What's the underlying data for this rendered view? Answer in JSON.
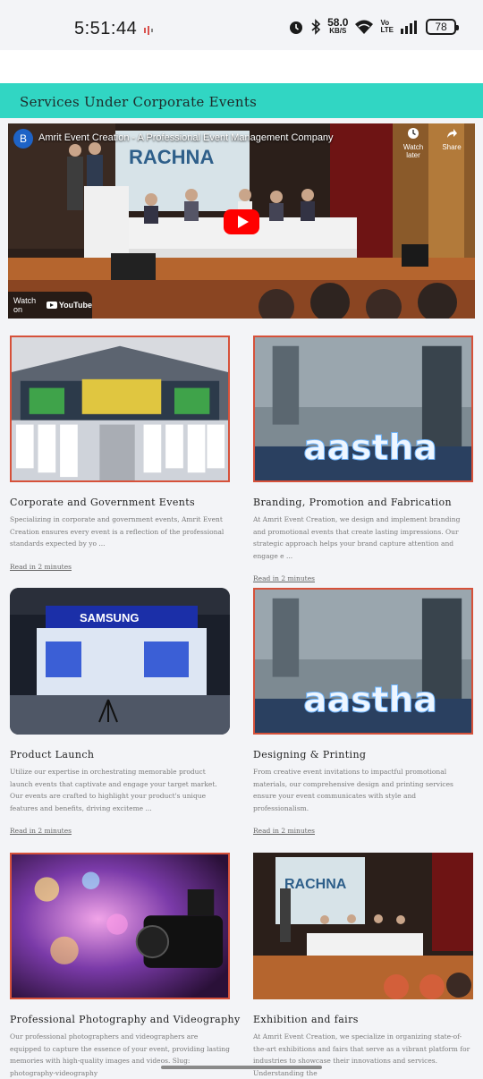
{
  "status_bar": {
    "time": "5:51:44",
    "net_speed_value": "58.0",
    "net_speed_unit": "KB/S",
    "volte_top": "Vo",
    "volte_bottom": "LTE",
    "battery": "78",
    "icons": [
      "screen-record-icon",
      "alarm-icon",
      "bluetooth-icon",
      "wifi-icon",
      "signal-icon"
    ]
  },
  "section": {
    "title": "Services Under Corporate Events",
    "header_color": "#31d6c3"
  },
  "video": {
    "channel_initial": "B",
    "title": "Amrit Event Creation - A Professional Event Management Company",
    "watch_later": "Watch later",
    "share": "Share",
    "watch_on": "Watch on",
    "youtube": "YouTube",
    "backdrop_text": "RACHNA"
  },
  "cards": [
    {
      "title": "Corporate and Government Events",
      "excerpt": "Specializing in corporate and government events, Amrit Event Creation ensures every event is a reflection of the professional standards expected by yo ...",
      "read": "Read in 2 minutes"
    },
    {
      "title": "Branding, Promotion and Fabrication",
      "excerpt": "At Amrit Event Creation, we design and implement branding and promotional events that create lasting impressions. Our strategic approach helps your brand capture attention and engage e ...",
      "read": "Read in 2 minutes",
      "image_text": "aastha"
    },
    {
      "title": "Product Launch",
      "excerpt": "Utilize our expertise in orchestrating memorable product launch events that captivate and engage your target market. Our events are crafted to highlight your product's unique features and benefits, driving exciteme ...",
      "read": "Read in 2 minutes",
      "image_text": "SAMSUNG"
    },
    {
      "title": "Designing & Printing",
      "excerpt": "From creative event invitations to impactful promotional materials, our comprehensive design and printing services ensure your event communicates with style and professionalism.",
      "read": "Read in 2 minutes",
      "image_text": "aastha"
    },
    {
      "title": "Professional Photography and Videography",
      "excerpt": "Our professional photographers and videographers are equipped to capture the essence of your event, providing lasting memories with high-quality images and videos. Slug: photography-videography"
    },
    {
      "title": "Exhibition and fairs",
      "excerpt": "At Amrit Event Creation, we specialize in organizing state-of-the-art exhibitions and fairs that serve as a vibrant platform for industries to showcase their innovations and services. Understanding the",
      "image_text": "RACHNA"
    }
  ],
  "accent_color": "#d6513a"
}
